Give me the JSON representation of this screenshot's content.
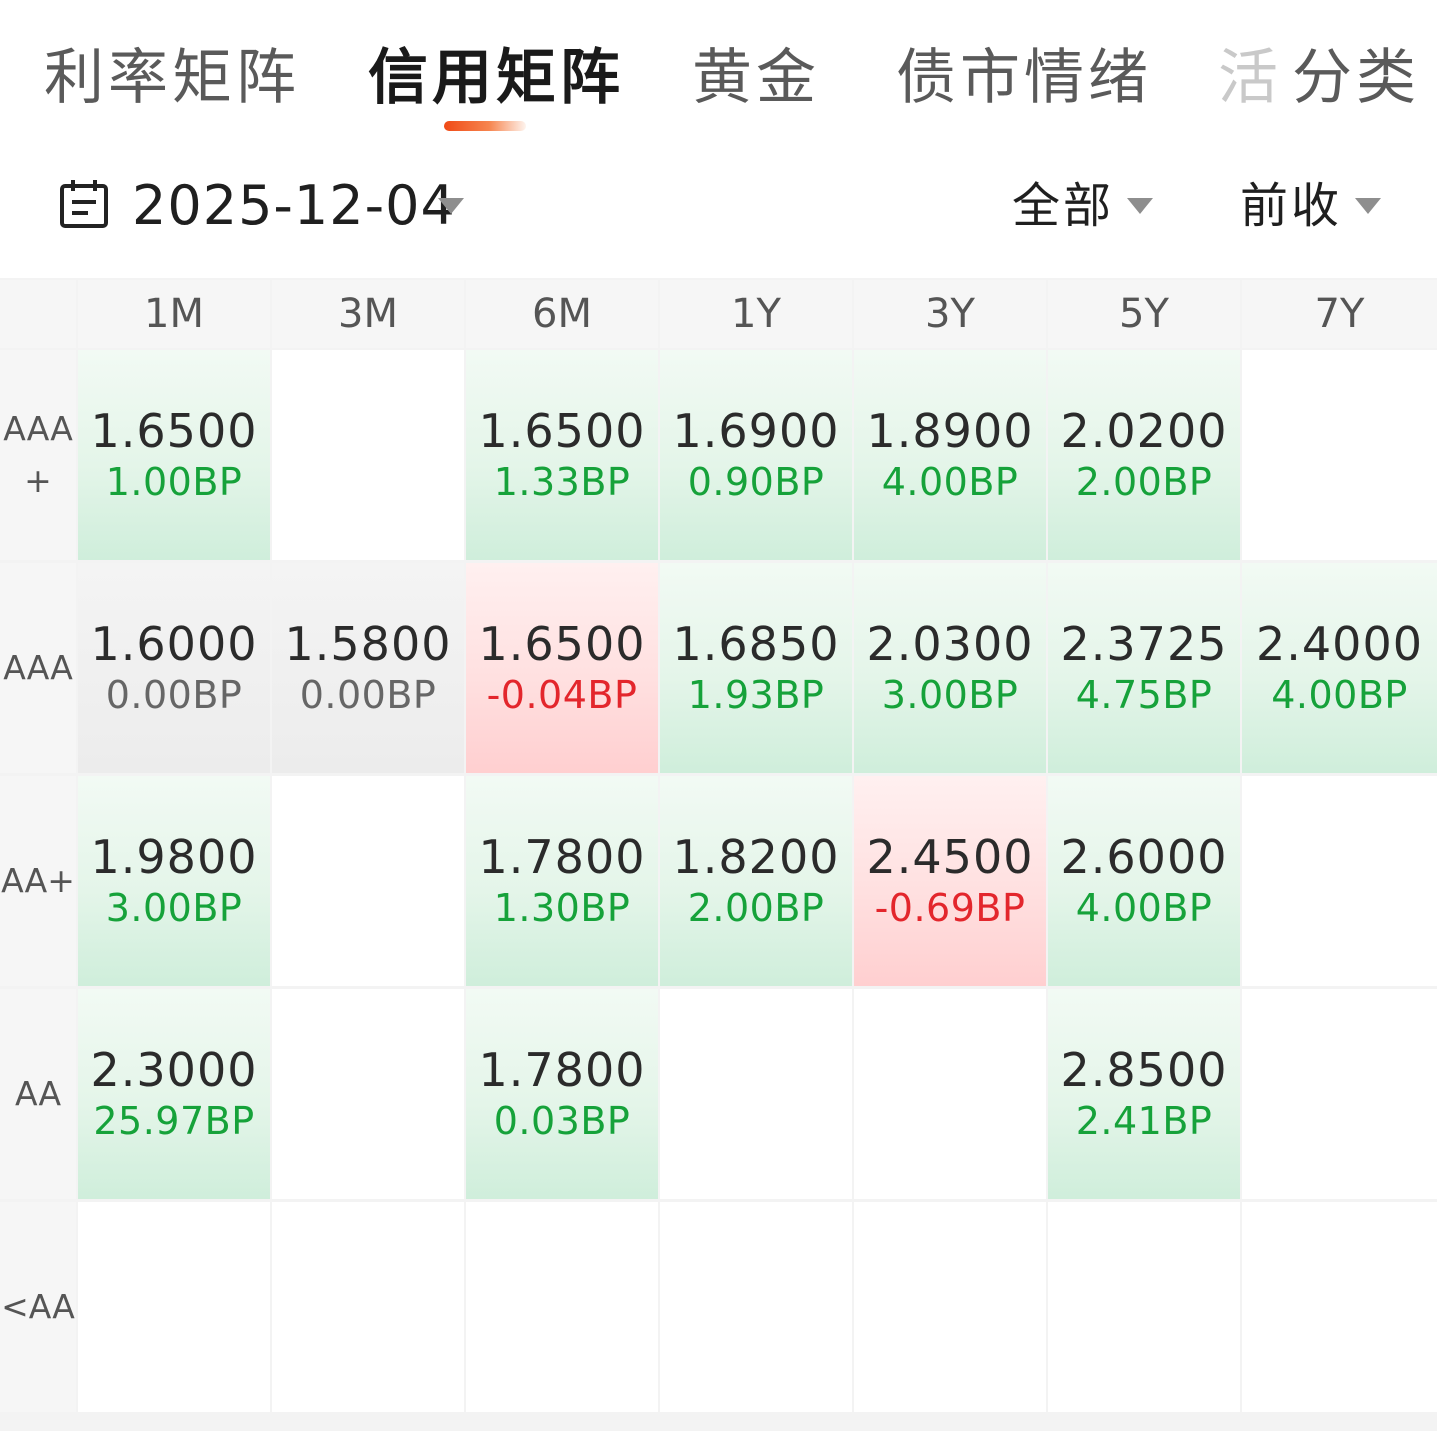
{
  "tabs": [
    {
      "label": "利率矩阵",
      "state": "normal"
    },
    {
      "label": "信用矩阵",
      "state": "active"
    },
    {
      "label": "黄金",
      "state": "normal"
    },
    {
      "label": "债市情绪",
      "state": "normal"
    },
    {
      "label": "活",
      "state": "faded"
    },
    {
      "label": "分类",
      "state": "normal"
    }
  ],
  "filters": {
    "date": "2025-12-04",
    "scope": "全部",
    "compare": "前收"
  },
  "icons": {
    "calendar": "calendar-icon",
    "dropdown": "caret-down-icon"
  },
  "colors": {
    "up": "#16a23a",
    "down": "#e3262c",
    "flat": "#666666",
    "accent": "#f04a16"
  },
  "matrix": {
    "columns": [
      "1M",
      "3M",
      "6M",
      "1Y",
      "3Y",
      "5Y",
      "7Y"
    ],
    "rows": [
      {
        "label": "AAA\n+",
        "cells": [
          {
            "rate": "1.6500",
            "change": "1.00BP",
            "dir": "up"
          },
          null,
          {
            "rate": "1.6500",
            "change": "1.33BP",
            "dir": "up"
          },
          {
            "rate": "1.6900",
            "change": "0.90BP",
            "dir": "up"
          },
          {
            "rate": "1.8900",
            "change": "4.00BP",
            "dir": "up"
          },
          {
            "rate": "2.0200",
            "change": "2.00BP",
            "dir": "up"
          },
          null
        ]
      },
      {
        "label": "AAA",
        "cells": [
          {
            "rate": "1.6000",
            "change": "0.00BP",
            "dir": "flat"
          },
          {
            "rate": "1.5800",
            "change": "0.00BP",
            "dir": "flat"
          },
          {
            "rate": "1.6500",
            "change": "-0.04BP",
            "dir": "down"
          },
          {
            "rate": "1.6850",
            "change": "1.93BP",
            "dir": "up"
          },
          {
            "rate": "2.0300",
            "change": "3.00BP",
            "dir": "up"
          },
          {
            "rate": "2.3725",
            "change": "4.75BP",
            "dir": "up"
          },
          {
            "rate": "2.4000",
            "change": "4.00BP",
            "dir": "up"
          }
        ]
      },
      {
        "label": "AA+",
        "cells": [
          {
            "rate": "1.9800",
            "change": "3.00BP",
            "dir": "up"
          },
          null,
          {
            "rate": "1.7800",
            "change": "1.30BP",
            "dir": "up"
          },
          {
            "rate": "1.8200",
            "change": "2.00BP",
            "dir": "up"
          },
          {
            "rate": "2.4500",
            "change": "-0.69BP",
            "dir": "down"
          },
          {
            "rate": "2.6000",
            "change": "4.00BP",
            "dir": "up"
          },
          null
        ]
      },
      {
        "label": "AA",
        "cells": [
          {
            "rate": "2.3000",
            "change": "25.97BP",
            "dir": "up"
          },
          null,
          {
            "rate": "1.7800",
            "change": "0.03BP",
            "dir": "up"
          },
          null,
          null,
          {
            "rate": "2.8500",
            "change": "2.41BP",
            "dir": "up"
          },
          null
        ]
      },
      {
        "label": "<AA",
        "cells": [
          null,
          null,
          null,
          null,
          null,
          null,
          null
        ]
      }
    ]
  }
}
